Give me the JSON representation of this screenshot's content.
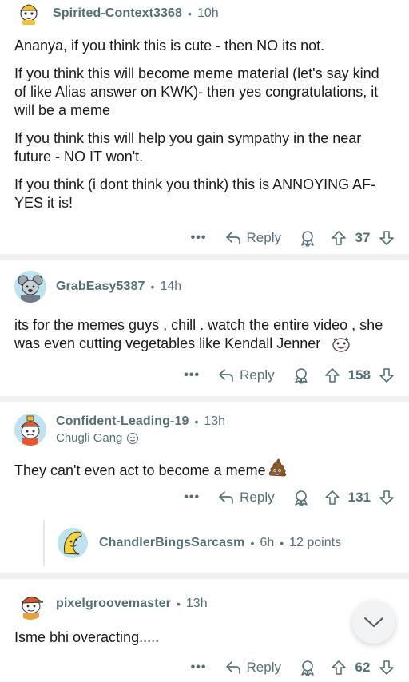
{
  "comments": [
    {
      "username": "Spirited-Context3368",
      "time": "10h",
      "paragraphs": [
        "Ananya, if you think this is cute - then NO its not.",
        "If you think this will become meme material (let's say kind of like Alias answer on KWK)- then yes congratulations, it will be a meme",
        "If you think this will help you gain sympathy in the near future - NO IT won't.",
        "If you think (i dont think you think) this is ANNOYING AF- YES it is!"
      ],
      "reply_label": "Reply",
      "score": "37",
      "more_label": "•••"
    },
    {
      "username": "GrabEasy5387",
      "time": "14h",
      "paragraphs": [
        "its for the memes guys , chill . watch the entire video , she was even cutting vegetables like Kendall Jenner"
      ],
      "reply_label": "Reply",
      "score": "158",
      "more_label": "•••"
    },
    {
      "username": "Confident-Leading-19",
      "time": "13h",
      "flair": "Chugli Gang",
      "paragraphs": [
        "They can't even act to become a meme"
      ],
      "reply_label": "Reply",
      "score": "131",
      "more_label": "•••"
    },
    {
      "username": "pixelgroovemaster",
      "time": "13h",
      "paragraphs": [
        "Isme bhi overacting....."
      ],
      "reply_label": "Reply",
      "score": "62",
      "more_label": "•••"
    }
  ],
  "collapsed_reply": {
    "username": "ChandlerBingsSarcasm",
    "time": "6h",
    "points": "12 points"
  },
  "separator": "•",
  "icons": {
    "reply": "reply-arrow-icon",
    "award": "award-icon",
    "upvote": "upvote-icon",
    "downvote": "downvote-icon",
    "scroll": "chevron-down-icon"
  },
  "colors": {
    "meta_text": "#576f76",
    "body_text": "#1a1a1b",
    "divider": "#eef0f1"
  }
}
